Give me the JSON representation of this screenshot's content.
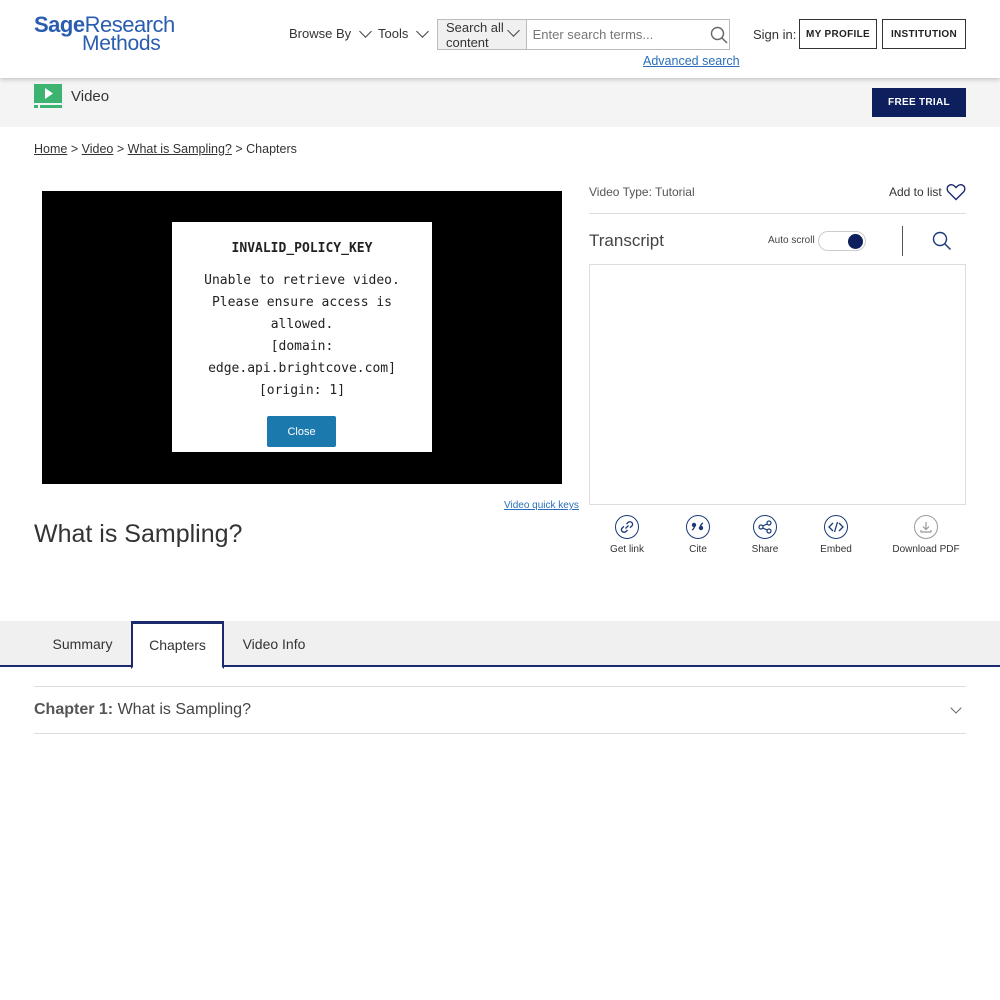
{
  "header": {
    "logo_line1_bold": "Sage",
    "logo_line1_rest": "Research",
    "logo_line2": "Methods",
    "nav": {
      "browse": "Browse By",
      "tools": "Tools"
    },
    "search": {
      "scope": "Search all content",
      "placeholder": "Enter search terms...",
      "advanced": "Advanced search"
    },
    "sign_in": "Sign in:",
    "my_profile": "MY PROFILE",
    "institution": "INSTITUTION"
  },
  "section": {
    "title": "Video",
    "free_trial": "FREE TRIAL"
  },
  "breadcrumb": {
    "home": "Home",
    "sep": ">",
    "video": "Video",
    "item": "What is Sampling?",
    "current": "Chapters"
  },
  "player": {
    "error_title": "INVALID_POLICY_KEY",
    "error_message": "Unable to retrieve video.\nPlease ensure access is\nallowed.\n[domain:\nedge.api.brightcove.com]\n[origin: 1]",
    "close": "Close",
    "quick_keys": "Video quick keys"
  },
  "page_title": "What is Sampling?",
  "right_panel": {
    "video_type": "Video Type: Tutorial",
    "add_to_list": "Add to list",
    "transcript": "Transcript",
    "auto_scroll": "Auto scroll",
    "auto_scroll_on": true
  },
  "actions": {
    "get_link": "Get link",
    "cite": "Cite",
    "share": "Share",
    "embed": "Embed",
    "download_pdf": "Download PDF"
  },
  "tabs": {
    "summary": "Summary",
    "chapters": "Chapters",
    "video_info": "Video Info",
    "active": "Chapters"
  },
  "chapter": {
    "label": "Chapter 1:",
    "title": "What is Sampling?"
  },
  "colors": {
    "brand_blue": "#2a5db0",
    "navy": "#0d1f5c",
    "close_button": "#1b79ae",
    "video_icon_green": "#3cb371"
  }
}
